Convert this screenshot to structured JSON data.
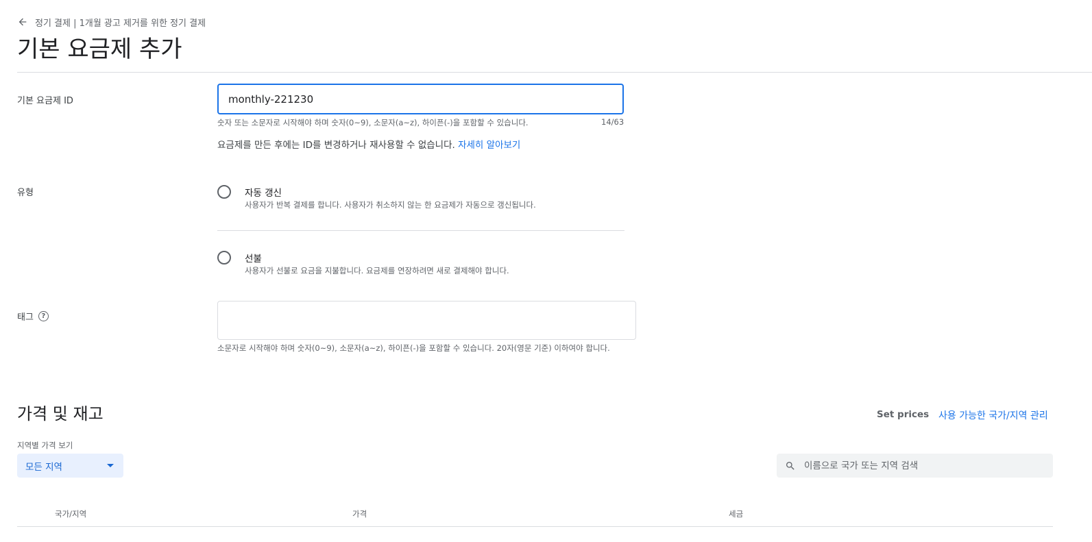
{
  "header": {
    "breadcrumb": "정기 결제 | 1개월 광고 제거를 위한 정기 결제",
    "title": "기본 요금제 추가"
  },
  "base_plan_id": {
    "label": "기본 요금제 ID",
    "value": "monthly-221230",
    "hint": "숫자 또는 소문자로 시작해야 하며 숫자(0~9), 소문자(a~z), 하이픈(-)을 포함할 수 있습니다.",
    "counter": "14/63",
    "note": "요금제를 만든 후에는 ID를 변경하거나 재사용할 수 없습니다.",
    "learn_more": "자세히 알아보기"
  },
  "type": {
    "label": "유형",
    "options": [
      {
        "title": "자동 갱신",
        "description": "사용자가 반복 결제를 합니다. 사용자가 취소하지 않는 한 요금제가 자동으로 갱신됩니다."
      },
      {
        "title": "선불",
        "description": "사용자가 선불로 요금을 지불합니다. 요금제를 연장하려면 새로 결제해야 합니다."
      }
    ]
  },
  "tags": {
    "label": "태그",
    "help_icon_glyph": "?",
    "value": "",
    "hint": "소문자로 시작해야 하며 숫자(0~9), 소문자(a~z), 하이픈(-)을 포함할 수 있습니다. 20자(영문 기준) 이하여야 합니다."
  },
  "pricing": {
    "title": "가격 및 재고",
    "set_prices": "Set prices",
    "manage_link": "사용 가능한 국가/지역 관리",
    "region_label": "지역별 가격 보기",
    "region_selected": "모든 지역",
    "search_placeholder": "이름으로 국가 또는 지역 검색",
    "columns": [
      "국가/지역",
      "가격",
      "세금"
    ]
  },
  "icons": {
    "back": "arrow-left-icon",
    "search": "search-icon",
    "dropdown": "caret-down-icon",
    "help": "help-circle-icon"
  },
  "colors": {
    "accent": "#1a73e8",
    "dropdown_bg": "#e8f0fe",
    "search_bg": "#f1f3f4",
    "divider": "#dadce0"
  }
}
